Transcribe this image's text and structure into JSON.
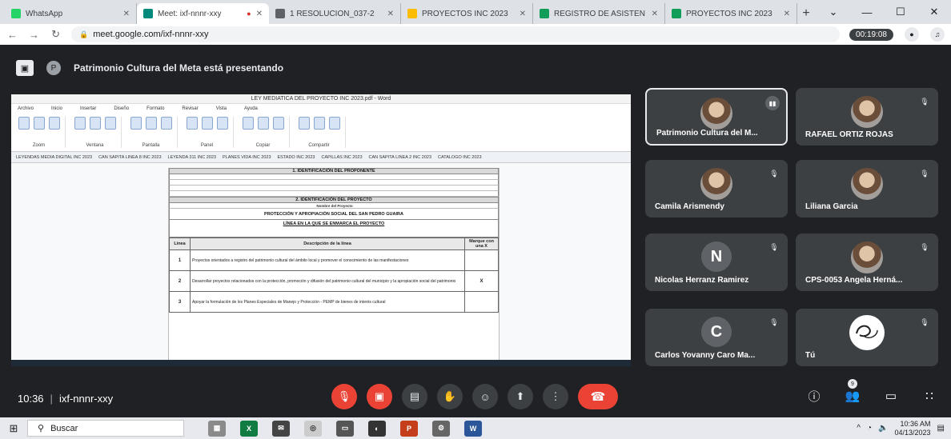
{
  "browser": {
    "tabs": [
      {
        "label": "WhatsApp",
        "fav_color": "#25d366",
        "active": false
      },
      {
        "label": "Meet: ixf-nnnr-xxy",
        "fav_color": "#00897b",
        "active": true
      },
      {
        "label": "1 RESOLUCION_037-2",
        "fav_color": "#5f6368",
        "active": false
      },
      {
        "label": "PROYECTOS INC 2023",
        "fav_color": "#fbbc04",
        "active": false
      },
      {
        "label": "REGISTRO DE ASISTEN",
        "fav_color": "#0f9d58",
        "active": false
      },
      {
        "label": "PROYECTOS INC 2023",
        "fav_color": "#0f9d58",
        "active": false
      }
    ],
    "url": "meet.google.com/ixf-nnnr-xxy",
    "timer": "00:19:08"
  },
  "meet": {
    "presenting_text": "Patrimonio Cultura del Meta está presentando",
    "meeting_time": "10:36",
    "meeting_code": "ixf-nnnr-xxy",
    "participants": [
      {
        "name": "Patrimonio Cultura del M...",
        "kind": "photo",
        "selected": true,
        "speaking": true
      },
      {
        "name": "RAFAEL ORTIZ ROJAS",
        "kind": "photo",
        "selected": false,
        "speaking": false
      },
      {
        "name": "Camila Arismendy",
        "kind": "photo",
        "selected": false,
        "speaking": false
      },
      {
        "name": "Liliana Garcia",
        "kind": "photo",
        "selected": false,
        "speaking": false
      },
      {
        "name": "Nicolas Herranz Ramirez",
        "kind": "letter",
        "letter": "N",
        "selected": false,
        "speaking": false
      },
      {
        "name": "CPS-0053 Angela Herná...",
        "kind": "photo",
        "selected": false,
        "speaking": false
      },
      {
        "name": "Carlos Yovanny Caro Ma...",
        "kind": "letter",
        "letter": "C",
        "selected": false,
        "speaking": false
      },
      {
        "name": "Tú",
        "kind": "logo",
        "selected": false,
        "speaking": false
      }
    ],
    "controls": [
      {
        "name": "mic-off-button",
        "icon": "mic-off-icon",
        "glyph": "🎙",
        "red": true
      },
      {
        "name": "camera-off-button",
        "icon": "camera-off-icon",
        "glyph": "▣",
        "red": true
      },
      {
        "name": "captions-button",
        "icon": "captions-icon",
        "glyph": "▤",
        "red": false
      },
      {
        "name": "raise-hand-button",
        "icon": "hand-icon",
        "glyph": "✋",
        "red": false
      },
      {
        "name": "reactions-button",
        "icon": "emoji-icon",
        "glyph": "☺",
        "red": false
      },
      {
        "name": "present-button",
        "icon": "present-icon",
        "glyph": "⬆",
        "red": false
      },
      {
        "name": "more-options-button",
        "icon": "more-vert-icon",
        "glyph": "⋮",
        "red": false
      }
    ],
    "right_controls": [
      {
        "name": "meeting-details-button",
        "icon": "info-icon",
        "glyph": "ⓘ"
      },
      {
        "name": "people-button",
        "icon": "people-icon",
        "glyph": "👥",
        "badge": "9"
      },
      {
        "name": "chat-button",
        "icon": "chat-icon",
        "glyph": "▭"
      },
      {
        "name": "activities-button",
        "icon": "activities-icon",
        "glyph": "∷"
      }
    ]
  },
  "document": {
    "title": "LEY MEDIATICA DEL PROYECTO INC 2023.pdf - Word",
    "tabs": [
      "Archivo",
      "Inicio",
      "Insertar",
      "Diseño",
      "Formato",
      "Revisar",
      "Vista",
      "Ayuda"
    ],
    "ribbon_groups": [
      "Zoom",
      "Ventana",
      "Pantalla",
      "Panel",
      "Copiar",
      "Compartir"
    ],
    "bookmarks": [
      "LEYENDAS MEDIA DIGITAL INC 2023",
      "CAN SAPITA LINEA 8 INC 2023",
      "LEYENDA 311 INC 2023",
      "PLANES VIDA INC 2023",
      "ESTADO INC 2023",
      "CAPILLAS INC 2023",
      "CAN SAPITA LINEA 2 INC 2023",
      "CATALOGO INC 2023"
    ],
    "section1": "1. IDENTIFICACIÓN DEL PROPONENTE",
    "section2": "2. IDENTIFICACIÓN DEL PROYECTO",
    "project_name_label": "Nombre del Proyecto",
    "project_name": "PROTECCIÓN Y APROPIACIÓN SOCIAL DEL SAN PEDRO GUAIRA",
    "line_header": "LÍNEA EN LA QUE SE ENMARCA EL PROYECTO",
    "table_headers": [
      "Línea",
      "Descripción de la línea",
      "Marque con una X"
    ],
    "rows": [
      {
        "num": "1",
        "desc": "Proyectos orientados a registro del patrimonio cultural del ámbito local y promover el conocimiento de las manifestaciones",
        "mark": ""
      },
      {
        "num": "2",
        "desc": "Desarrollar proyectos relacionados con la protección, promoción y difusión del patrimonio cultural del municipio y la apropiación social del patrimonio",
        "mark": "X"
      },
      {
        "num": "3",
        "desc": "Apoyar la formulación de los Planes Especiales de Manejo y Protección - PEMP de bienes de interés cultural",
        "mark": ""
      }
    ]
  },
  "taskbar": {
    "search_placeholder": "Buscar",
    "time": "10:36 AM",
    "date": "04/13/2023"
  }
}
